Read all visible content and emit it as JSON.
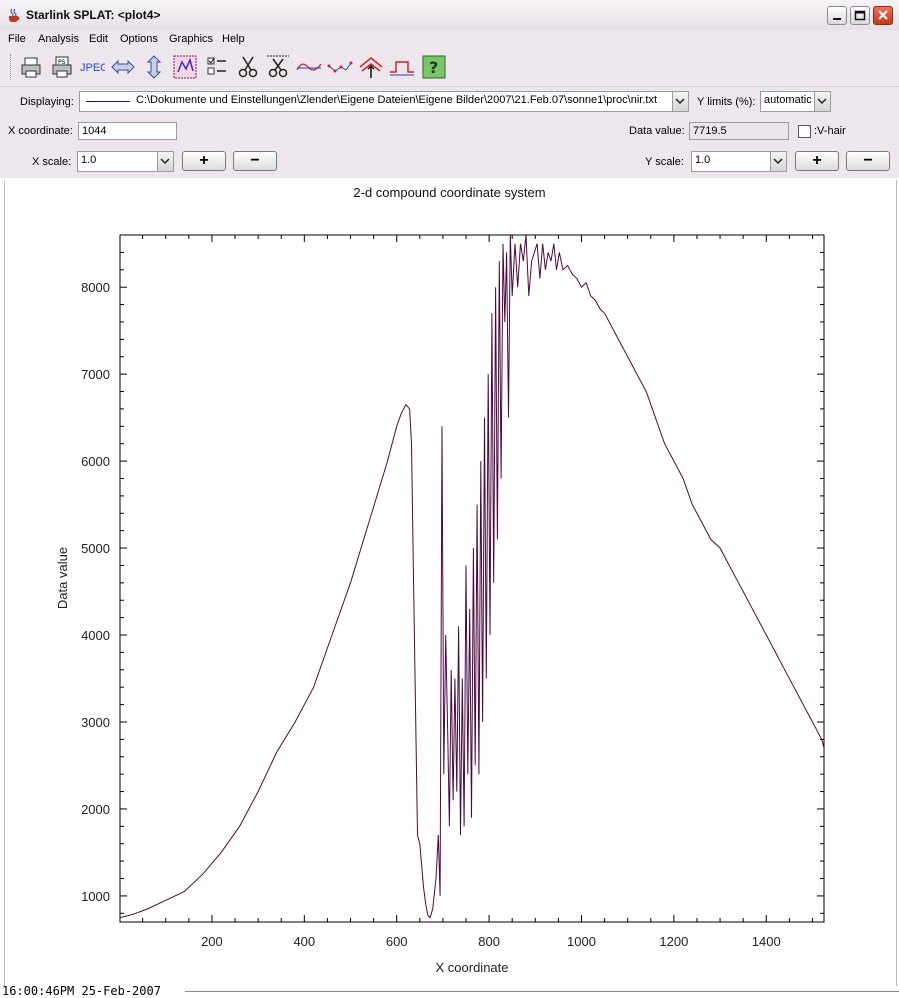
{
  "window": {
    "title": "Starlink SPLAT: <plot4>"
  },
  "menu": [
    "File",
    "Analysis",
    "Edit",
    "Options",
    "Graphics",
    "Help"
  ],
  "toolbar": {
    "icons": [
      "print-icon",
      "postscript-icon",
      "jpeg-icon",
      "fit-width-icon",
      "fit-height-icon",
      "zoom-region-icon",
      "select-spectra-icon",
      "cut-icon",
      "cut-all-icon",
      "line-fit-icon",
      "polyline-icon",
      "peak-up-icon",
      "background-icon",
      "help-icon"
    ],
    "jpeg_label": "JPEG"
  },
  "controls": {
    "displaying_label": "Displaying:",
    "displaying_value": "C:\\Dokumente und Einstellungen\\Zlender\\Eigene Dateien\\Eigene Bilder\\2007\\21.Feb.07\\sonne1\\proc\\nir.txt",
    "ylimits_label": "Y limits (%):",
    "ylimits_value": "automatic",
    "xcoord_label": "X coordinate:",
    "xcoord_value": "1044",
    "datavalue_label": "Data value:",
    "datavalue_value": "7719.5",
    "vhair_label": ":V-hair",
    "xscale_label": "X scale:",
    "xscale_value": "1.0",
    "yscale_label": "Y scale:",
    "yscale_value": "1.0",
    "plus": "+",
    "minus": "−"
  },
  "colors": {
    "series": "#4b0a3f",
    "chrome": "#ede6ed"
  },
  "chart_data": {
    "type": "line",
    "title": "2-d compound coordinate system",
    "xlabel": "X coordinate",
    "ylabel": "Data value",
    "xlim": [
      1,
      1525
    ],
    "ylim": [
      700,
      8600
    ],
    "xticks": [
      200,
      400,
      600,
      800,
      1000,
      1200,
      1400
    ],
    "yticks": [
      1000,
      2000,
      3000,
      4000,
      5000,
      6000,
      7000,
      8000
    ],
    "series": [
      {
        "x": [
          1,
          30,
          60,
          100,
          140,
          180,
          220,
          260,
          300,
          340,
          380,
          420,
          460,
          500,
          540,
          580,
          600,
          610,
          620,
          628,
          632,
          636,
          645,
          650,
          658,
          663,
          667,
          672,
          678,
          685,
          690,
          694,
          698,
          702,
          706,
          710,
          714,
          718,
          722,
          726,
          730,
          734,
          738,
          742,
          746,
          750,
          754,
          758,
          762,
          766,
          770,
          774,
          778,
          782,
          786,
          790,
          794,
          798,
          802,
          806,
          810,
          814,
          818,
          822,
          826,
          830,
          834,
          838,
          842,
          846,
          850,
          856,
          862,
          868,
          874,
          880,
          886,
          892,
          898,
          904,
          910,
          916,
          922,
          928,
          934,
          940,
          946,
          952,
          960,
          970,
          980,
          990,
          1000,
          1010,
          1020,
          1030,
          1040,
          1050,
          1060,
          1070,
          1080,
          1090,
          1100,
          1120,
          1140,
          1160,
          1180,
          1200,
          1220,
          1240,
          1260,
          1280,
          1300,
          1320,
          1340,
          1360,
          1380,
          1400,
          1420,
          1440,
          1460,
          1480,
          1500,
          1510,
          1520,
          1525
        ],
        "y": [
          750,
          790,
          850,
          950,
          1050,
          1250,
          1500,
          1800,
          2200,
          2650,
          3000,
          3400,
          4000,
          4600,
          5300,
          6000,
          6400,
          6550,
          6650,
          6600,
          6200,
          4800,
          1700,
          1600,
          1100,
          900,
          780,
          750,
          850,
          1200,
          1700,
          1000,
          6400,
          2400,
          4000,
          3000,
          1800,
          3600,
          2100,
          3500,
          2200,
          4100,
          1700,
          3500,
          1800,
          4800,
          2400,
          4300,
          1900,
          5000,
          2500,
          5500,
          2400,
          6000,
          3000,
          6500,
          3500,
          7000,
          4000,
          7700,
          4600,
          8000,
          5100,
          8300,
          5800,
          8500,
          7600,
          8400,
          6500,
          8600,
          7900,
          8500,
          8000,
          8500,
          8300,
          8600,
          7900,
          8300,
          8400,
          8500,
          8100,
          8500,
          8200,
          8400,
          8300,
          8500,
          8200,
          8400,
          8200,
          8250,
          8150,
          8100,
          8000,
          8050,
          7900,
          7850,
          7750,
          7700,
          7600,
          7500,
          7400,
          7300,
          7200,
          7000,
          6800,
          6500,
          6200,
          6000,
          5800,
          5500,
          5300,
          5100,
          5000,
          4800,
          4600,
          4400,
          4200,
          4000,
          3800,
          3600,
          3400,
          3200,
          3000,
          2900,
          2800,
          2700
        ]
      }
    ]
  }
}
